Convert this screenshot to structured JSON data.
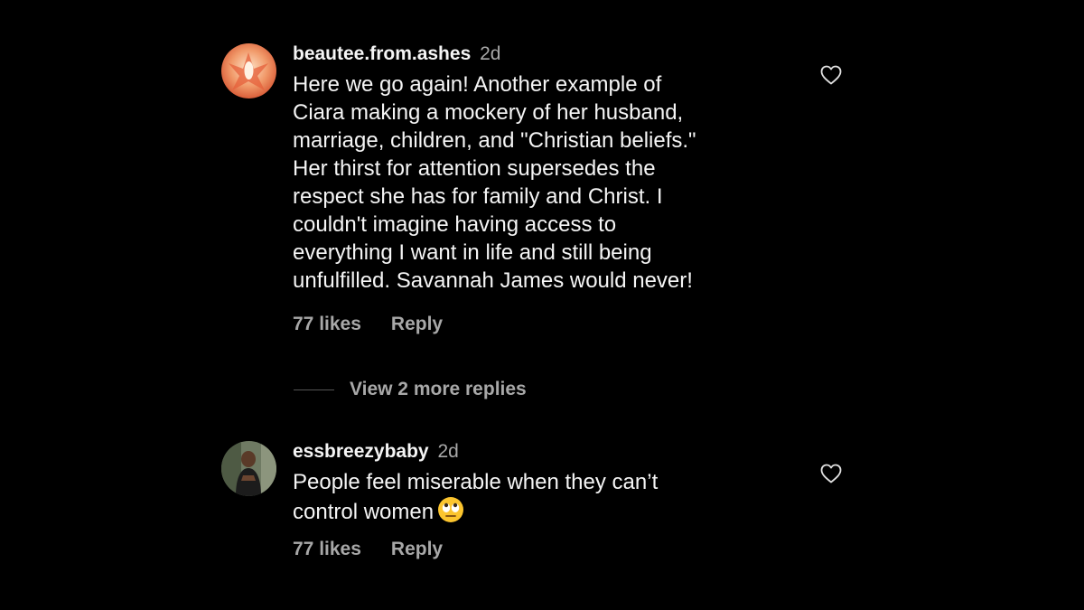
{
  "comments": [
    {
      "username": "beautee.from.ashes",
      "time": "2d",
      "text": "Here we go again! Another example of\nCiara making a mockery of her husband,\nmarriage, children, and \"Christian beliefs.\"\nHer thirst for attention supersedes the\nrespect she has for family and Christ. I\ncouldn't imagine having access to\neverything I want in life and still being\nunfulfilled. Savannah James would never!",
      "likes": "77 likes",
      "reply": "Reply",
      "avatar_icon": "phoenix-avatar",
      "like_icon": "heart-outline-icon"
    },
    {
      "username": "essbreezybaby",
      "time": "2d",
      "text": "People feel miserable when they can’t\ncontrol women",
      "emoji": "eye-roll-emoji-icon",
      "likes": "77 likes",
      "reply": "Reply",
      "avatar_icon": "portrait-avatar",
      "like_icon": "heart-outline-icon"
    }
  ],
  "view_replies": "View 2 more replies",
  "colors": {
    "background": "#000000",
    "primary_text": "#f5f5f5",
    "secondary_text": "#a8a8a8"
  }
}
